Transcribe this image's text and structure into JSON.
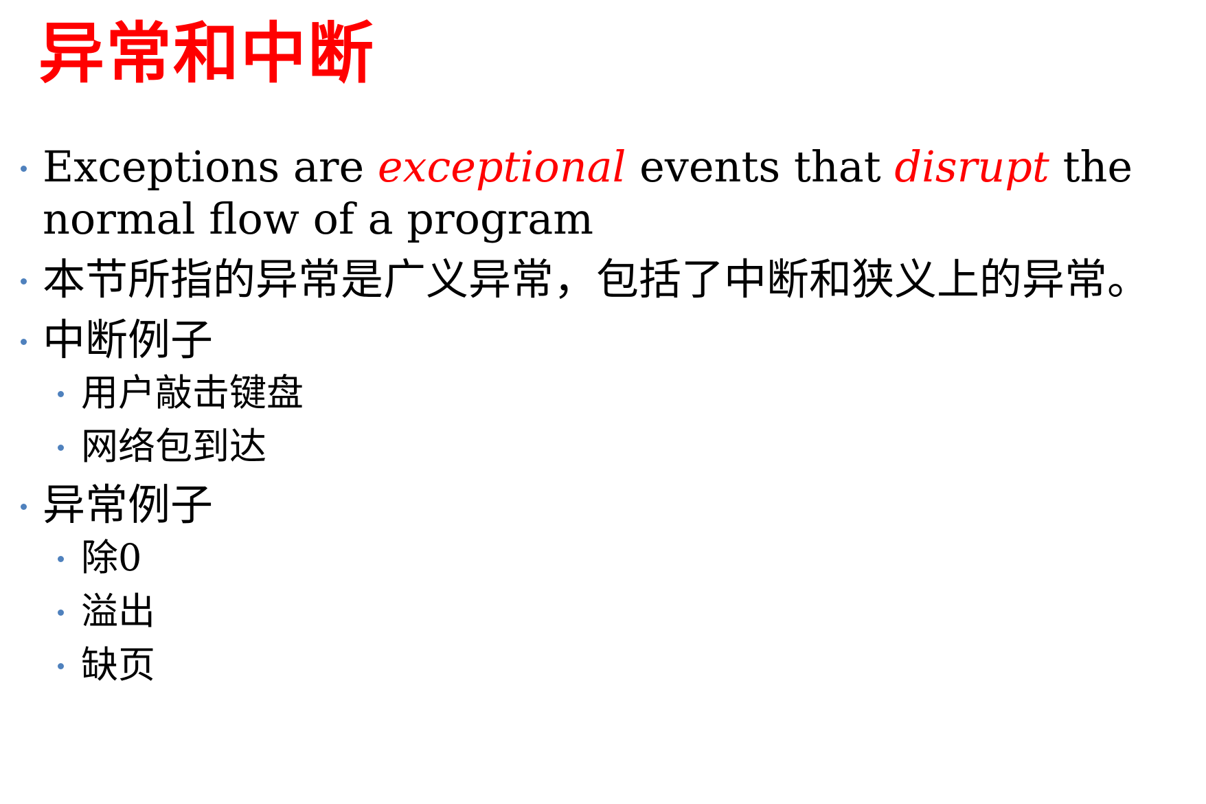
{
  "colors": {
    "title": "#ff0000",
    "emphasis": "#ff0000",
    "bullet": "#4f81bd",
    "text": "#000000"
  },
  "title": "异常和中断",
  "bullets": {
    "b1": {
      "part1": "Exceptions are ",
      "em1": "exceptional",
      "part2": " events that ",
      "em2": "disrupt",
      "part3": " the normal flow of a program"
    },
    "b2": "本节所指的异常是广义异常，包括了中断和狭义上的异常。",
    "b3": {
      "label": "中断例子",
      "sub": [
        "用户敲击键盘",
        "网络包到达"
      ]
    },
    "b4": {
      "label": "异常例子",
      "sub": [
        "除0",
        "溢出",
        "缺页"
      ]
    }
  }
}
